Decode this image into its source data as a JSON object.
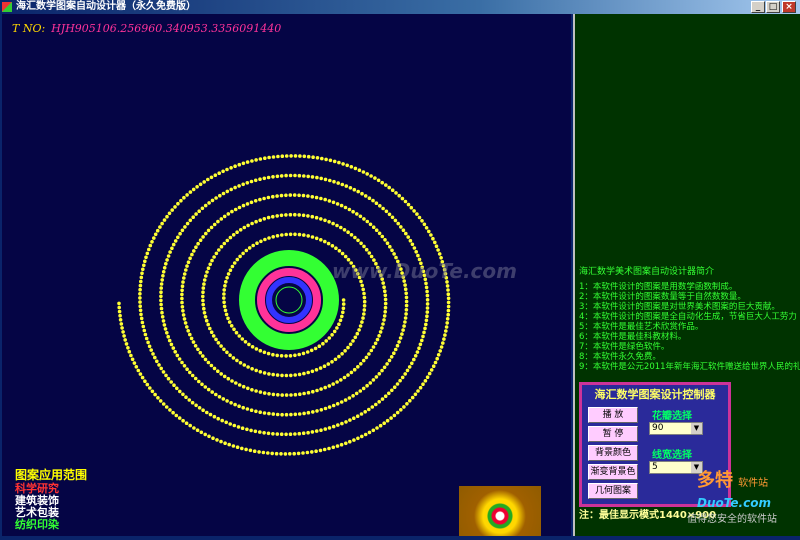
{
  "window": {
    "title": "海汇数学图案自动设计器（永久免费版）",
    "min_label": "_",
    "max_label": "□",
    "close_label": "×"
  },
  "canvas": {
    "tno_label": "T NO:",
    "tno_value": "HJH905106.256960.340953.3356091440",
    "watermark": "www.DuoTe.com",
    "pattern_colors": {
      "background": "#050545",
      "dots": "#ffff33",
      "green": "#33ff33",
      "pink": "#ff3399",
      "blue": "#3333ff"
    }
  },
  "applications": {
    "header": "图案应用范围",
    "items": [
      "科学研究",
      "建筑装饰",
      "艺术包装",
      "纺织印染"
    ]
  },
  "intro": {
    "title": "海汇数学美术图案自动设计器简介",
    "items": [
      "1：本软件设计的图案是用数学函数制成。",
      "2：本软件设计的图案数量等于自然数数量。",
      "3：本软件设计的图案是对世界美术图案的巨大贡献。",
      "4：本软件设计的图案是全自动化生成，节省巨大人工劳力",
      "5：本软件是最佳艺术欣赏作品。",
      "6：本软件是最佳科教材料。",
      "7：本软件是绿色软件。",
      "8：本软件永久免费。",
      "9：本软件是公元2011年新年海汇软件赠送给世界人民的礼"
    ]
  },
  "controller": {
    "title": "海汇数学图案设计控制器",
    "buttons": {
      "play": "播 放",
      "pause": "暂 停",
      "bg_color": "背景颜色",
      "gradient_bg": "渐变背景色",
      "geometric": "几何图案"
    },
    "select1": {
      "label": "花瓣选择",
      "value": "90"
    },
    "select2": {
      "label": "线宽选择",
      "value": "5"
    }
  },
  "note": "注：最佳显示模式1440×900",
  "watermark_logo": {
    "big": "多特",
    "small": "软件站",
    "domain": "DuoTe.com",
    "slogan": "值得您安全的软件站"
  }
}
